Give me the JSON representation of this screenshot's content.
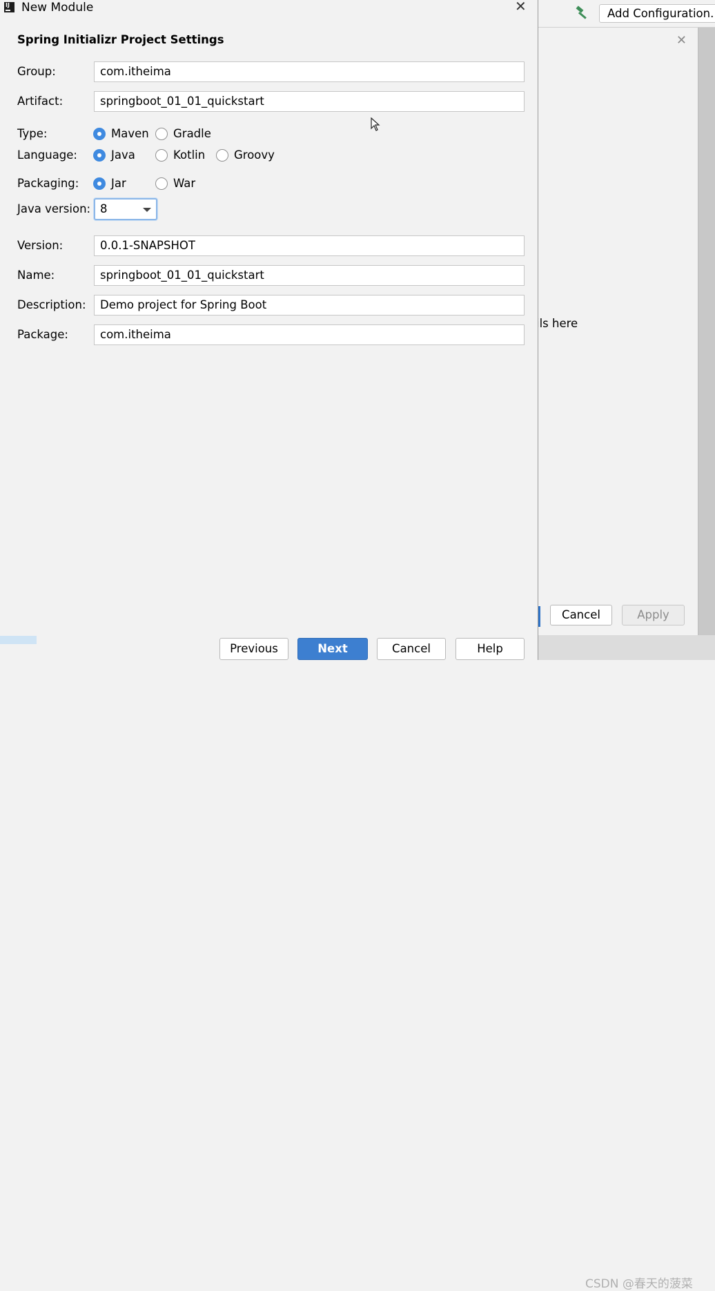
{
  "background_ide": {
    "toolbar": {
      "hammer_icon": "hammer-icon",
      "add_configuration_label": "Add Configuration..."
    },
    "dialog": {
      "hint_text": "ils here",
      "cancel_label": "Cancel",
      "apply_label": "Apply"
    },
    "watermark": "CSDN @春天的菠菜"
  },
  "dialog": {
    "title": "New Module",
    "heading": "Spring Initializr Project Settings",
    "fields": {
      "group": {
        "label": "Group:",
        "value": "com.itheima"
      },
      "artifact": {
        "label": "Artifact:",
        "value": "springboot_01_01_quickstart"
      },
      "version": {
        "label": "Version:",
        "value": "0.0.1-SNAPSHOT"
      },
      "name": {
        "label": "Name:",
        "value": "springboot_01_01_quickstart"
      },
      "description": {
        "label": "Description:",
        "value": "Demo project for Spring Boot"
      },
      "package": {
        "label": "Package:",
        "value": "com.itheima"
      }
    },
    "type": {
      "label": "Type:",
      "options": [
        "Maven",
        "Gradle"
      ],
      "selected": "Maven"
    },
    "language": {
      "label": "Language:",
      "options": [
        "Java",
        "Kotlin",
        "Groovy"
      ],
      "selected": "Java"
    },
    "packaging": {
      "label": "Packaging:",
      "options": [
        "Jar",
        "War"
      ],
      "selected": "Jar"
    },
    "java_version": {
      "label": "Java version:",
      "value": "8"
    },
    "buttons": {
      "previous": "Previous",
      "next": "Next",
      "cancel": "Cancel",
      "help": "Help"
    }
  },
  "colors": {
    "accent": "#3f8ae0",
    "primary_button": "#3d7fd0",
    "focus_border": "#8cb7e8"
  }
}
